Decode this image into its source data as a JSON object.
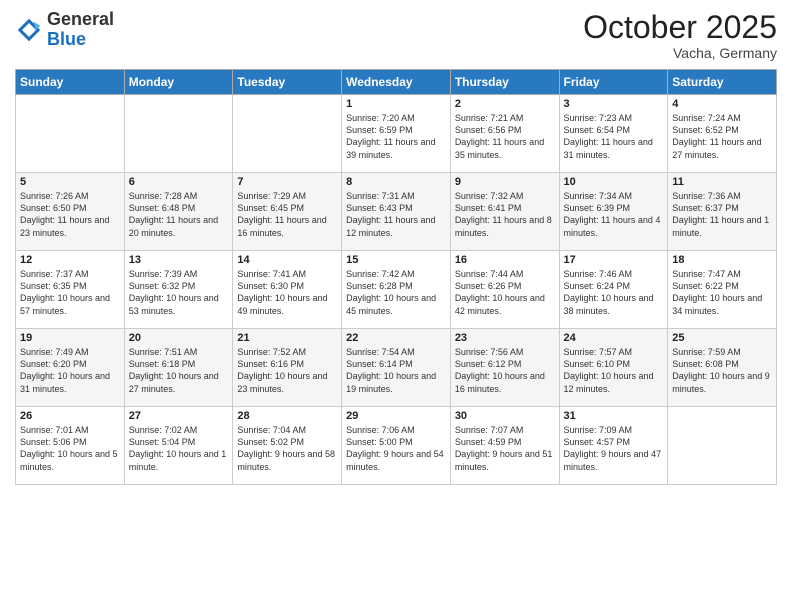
{
  "logo": {
    "general": "General",
    "blue": "Blue"
  },
  "header": {
    "title": "October 2025",
    "location": "Vacha, Germany"
  },
  "days_of_week": [
    "Sunday",
    "Monday",
    "Tuesday",
    "Wednesday",
    "Thursday",
    "Friday",
    "Saturday"
  ],
  "weeks": [
    [
      {
        "day": "",
        "info": ""
      },
      {
        "day": "",
        "info": ""
      },
      {
        "day": "",
        "info": ""
      },
      {
        "day": "1",
        "info": "Sunrise: 7:20 AM\nSunset: 6:59 PM\nDaylight: 11 hours\nand 39 minutes."
      },
      {
        "day": "2",
        "info": "Sunrise: 7:21 AM\nSunset: 6:56 PM\nDaylight: 11 hours\nand 35 minutes."
      },
      {
        "day": "3",
        "info": "Sunrise: 7:23 AM\nSunset: 6:54 PM\nDaylight: 11 hours\nand 31 minutes."
      },
      {
        "day": "4",
        "info": "Sunrise: 7:24 AM\nSunset: 6:52 PM\nDaylight: 11 hours\nand 27 minutes."
      }
    ],
    [
      {
        "day": "5",
        "info": "Sunrise: 7:26 AM\nSunset: 6:50 PM\nDaylight: 11 hours\nand 23 minutes."
      },
      {
        "day": "6",
        "info": "Sunrise: 7:28 AM\nSunset: 6:48 PM\nDaylight: 11 hours\nand 20 minutes."
      },
      {
        "day": "7",
        "info": "Sunrise: 7:29 AM\nSunset: 6:45 PM\nDaylight: 11 hours\nand 16 minutes."
      },
      {
        "day": "8",
        "info": "Sunrise: 7:31 AM\nSunset: 6:43 PM\nDaylight: 11 hours\nand 12 minutes."
      },
      {
        "day": "9",
        "info": "Sunrise: 7:32 AM\nSunset: 6:41 PM\nDaylight: 11 hours\nand 8 minutes."
      },
      {
        "day": "10",
        "info": "Sunrise: 7:34 AM\nSunset: 6:39 PM\nDaylight: 11 hours\nand 4 minutes."
      },
      {
        "day": "11",
        "info": "Sunrise: 7:36 AM\nSunset: 6:37 PM\nDaylight: 11 hours\nand 1 minute."
      }
    ],
    [
      {
        "day": "12",
        "info": "Sunrise: 7:37 AM\nSunset: 6:35 PM\nDaylight: 10 hours\nand 57 minutes."
      },
      {
        "day": "13",
        "info": "Sunrise: 7:39 AM\nSunset: 6:32 PM\nDaylight: 10 hours\nand 53 minutes."
      },
      {
        "day": "14",
        "info": "Sunrise: 7:41 AM\nSunset: 6:30 PM\nDaylight: 10 hours\nand 49 minutes."
      },
      {
        "day": "15",
        "info": "Sunrise: 7:42 AM\nSunset: 6:28 PM\nDaylight: 10 hours\nand 45 minutes."
      },
      {
        "day": "16",
        "info": "Sunrise: 7:44 AM\nSunset: 6:26 PM\nDaylight: 10 hours\nand 42 minutes."
      },
      {
        "day": "17",
        "info": "Sunrise: 7:46 AM\nSunset: 6:24 PM\nDaylight: 10 hours\nand 38 minutes."
      },
      {
        "day": "18",
        "info": "Sunrise: 7:47 AM\nSunset: 6:22 PM\nDaylight: 10 hours\nand 34 minutes."
      }
    ],
    [
      {
        "day": "19",
        "info": "Sunrise: 7:49 AM\nSunset: 6:20 PM\nDaylight: 10 hours\nand 31 minutes."
      },
      {
        "day": "20",
        "info": "Sunrise: 7:51 AM\nSunset: 6:18 PM\nDaylight: 10 hours\nand 27 minutes."
      },
      {
        "day": "21",
        "info": "Sunrise: 7:52 AM\nSunset: 6:16 PM\nDaylight: 10 hours\nand 23 minutes."
      },
      {
        "day": "22",
        "info": "Sunrise: 7:54 AM\nSunset: 6:14 PM\nDaylight: 10 hours\nand 19 minutes."
      },
      {
        "day": "23",
        "info": "Sunrise: 7:56 AM\nSunset: 6:12 PM\nDaylight: 10 hours\nand 16 minutes."
      },
      {
        "day": "24",
        "info": "Sunrise: 7:57 AM\nSunset: 6:10 PM\nDaylight: 10 hours\nand 12 minutes."
      },
      {
        "day": "25",
        "info": "Sunrise: 7:59 AM\nSunset: 6:08 PM\nDaylight: 10 hours\nand 9 minutes."
      }
    ],
    [
      {
        "day": "26",
        "info": "Sunrise: 7:01 AM\nSunset: 5:06 PM\nDaylight: 10 hours\nand 5 minutes."
      },
      {
        "day": "27",
        "info": "Sunrise: 7:02 AM\nSunset: 5:04 PM\nDaylight: 10 hours\nand 1 minute."
      },
      {
        "day": "28",
        "info": "Sunrise: 7:04 AM\nSunset: 5:02 PM\nDaylight: 9 hours\nand 58 minutes."
      },
      {
        "day": "29",
        "info": "Sunrise: 7:06 AM\nSunset: 5:00 PM\nDaylight: 9 hours\nand 54 minutes."
      },
      {
        "day": "30",
        "info": "Sunrise: 7:07 AM\nSunset: 4:59 PM\nDaylight: 9 hours\nand 51 minutes."
      },
      {
        "day": "31",
        "info": "Sunrise: 7:09 AM\nSunset: 4:57 PM\nDaylight: 9 hours\nand 47 minutes."
      },
      {
        "day": "",
        "info": ""
      }
    ]
  ]
}
